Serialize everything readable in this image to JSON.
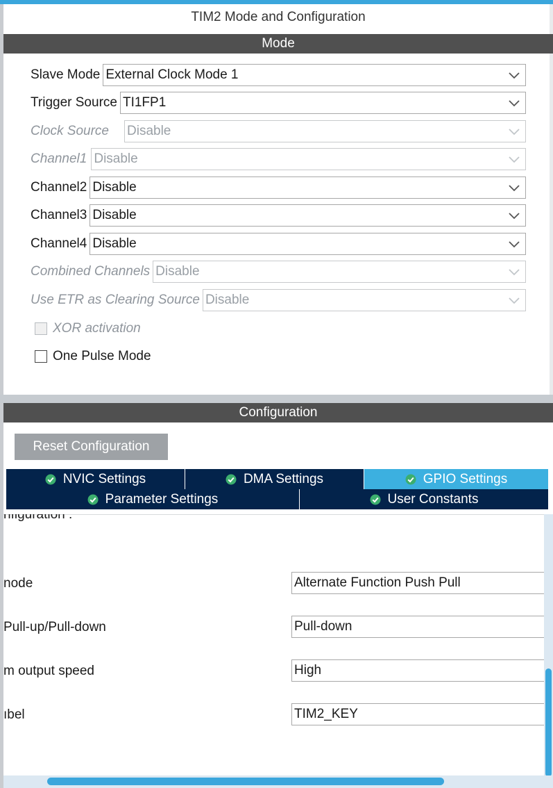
{
  "window": {
    "title": "TIM2 Mode and Configuration"
  },
  "mode_section": {
    "title": "Mode",
    "rows": [
      {
        "label": "Slave Mode",
        "value": "External Clock Mode 1",
        "enabled": true
      },
      {
        "label": "Trigger Source",
        "value": "TI1FP1",
        "enabled": true
      },
      {
        "label": "Clock Source",
        "value": "Disable",
        "enabled": false
      },
      {
        "label": "Channel1",
        "value": "Disable",
        "enabled": false
      },
      {
        "label": "Channel2",
        "value": "Disable",
        "enabled": true
      },
      {
        "label": "Channel3",
        "value": "Disable",
        "enabled": true
      },
      {
        "label": "Channel4",
        "value": "Disable",
        "enabled": true
      },
      {
        "label": "Combined Channels",
        "value": "Disable",
        "enabled": false
      },
      {
        "label": "Use ETR as Clearing Source",
        "value": "Disable",
        "enabled": false
      }
    ],
    "checkboxes": [
      {
        "label": "XOR activation",
        "checked": false,
        "enabled": false
      },
      {
        "label": "One Pulse Mode",
        "checked": false,
        "enabled": true
      }
    ]
  },
  "config_section": {
    "title": "Configuration",
    "reset_label": "Reset Configuration",
    "tabs": [
      {
        "label": "NVIC Settings",
        "active": false
      },
      {
        "label": "DMA Settings",
        "active": false
      },
      {
        "label": "GPIO Settings",
        "active": true
      },
      {
        "label": "Parameter Settings",
        "active": false
      },
      {
        "label": "User Constants",
        "active": false
      }
    ],
    "gpio_heading_partial": "nfiguration :",
    "gpio_rows": [
      {
        "label_partial": "node",
        "value": "Alternate Function Push Pull"
      },
      {
        "label_partial": "Pull-up/Pull-down",
        "value": "Pull-down"
      },
      {
        "label_partial": "m output speed",
        "value": "High"
      },
      {
        "label_partial": "ıbel",
        "value": "TIM2_KEY"
      }
    ]
  },
  "colors": {
    "accent": "#3aa6dc",
    "tab_dark": "#03234b",
    "section_bar": "#505050",
    "ok_green": "#3cae6e"
  },
  "icons": {
    "dropdown": "chevron-down-icon",
    "tab_status": "check-circle-icon"
  }
}
